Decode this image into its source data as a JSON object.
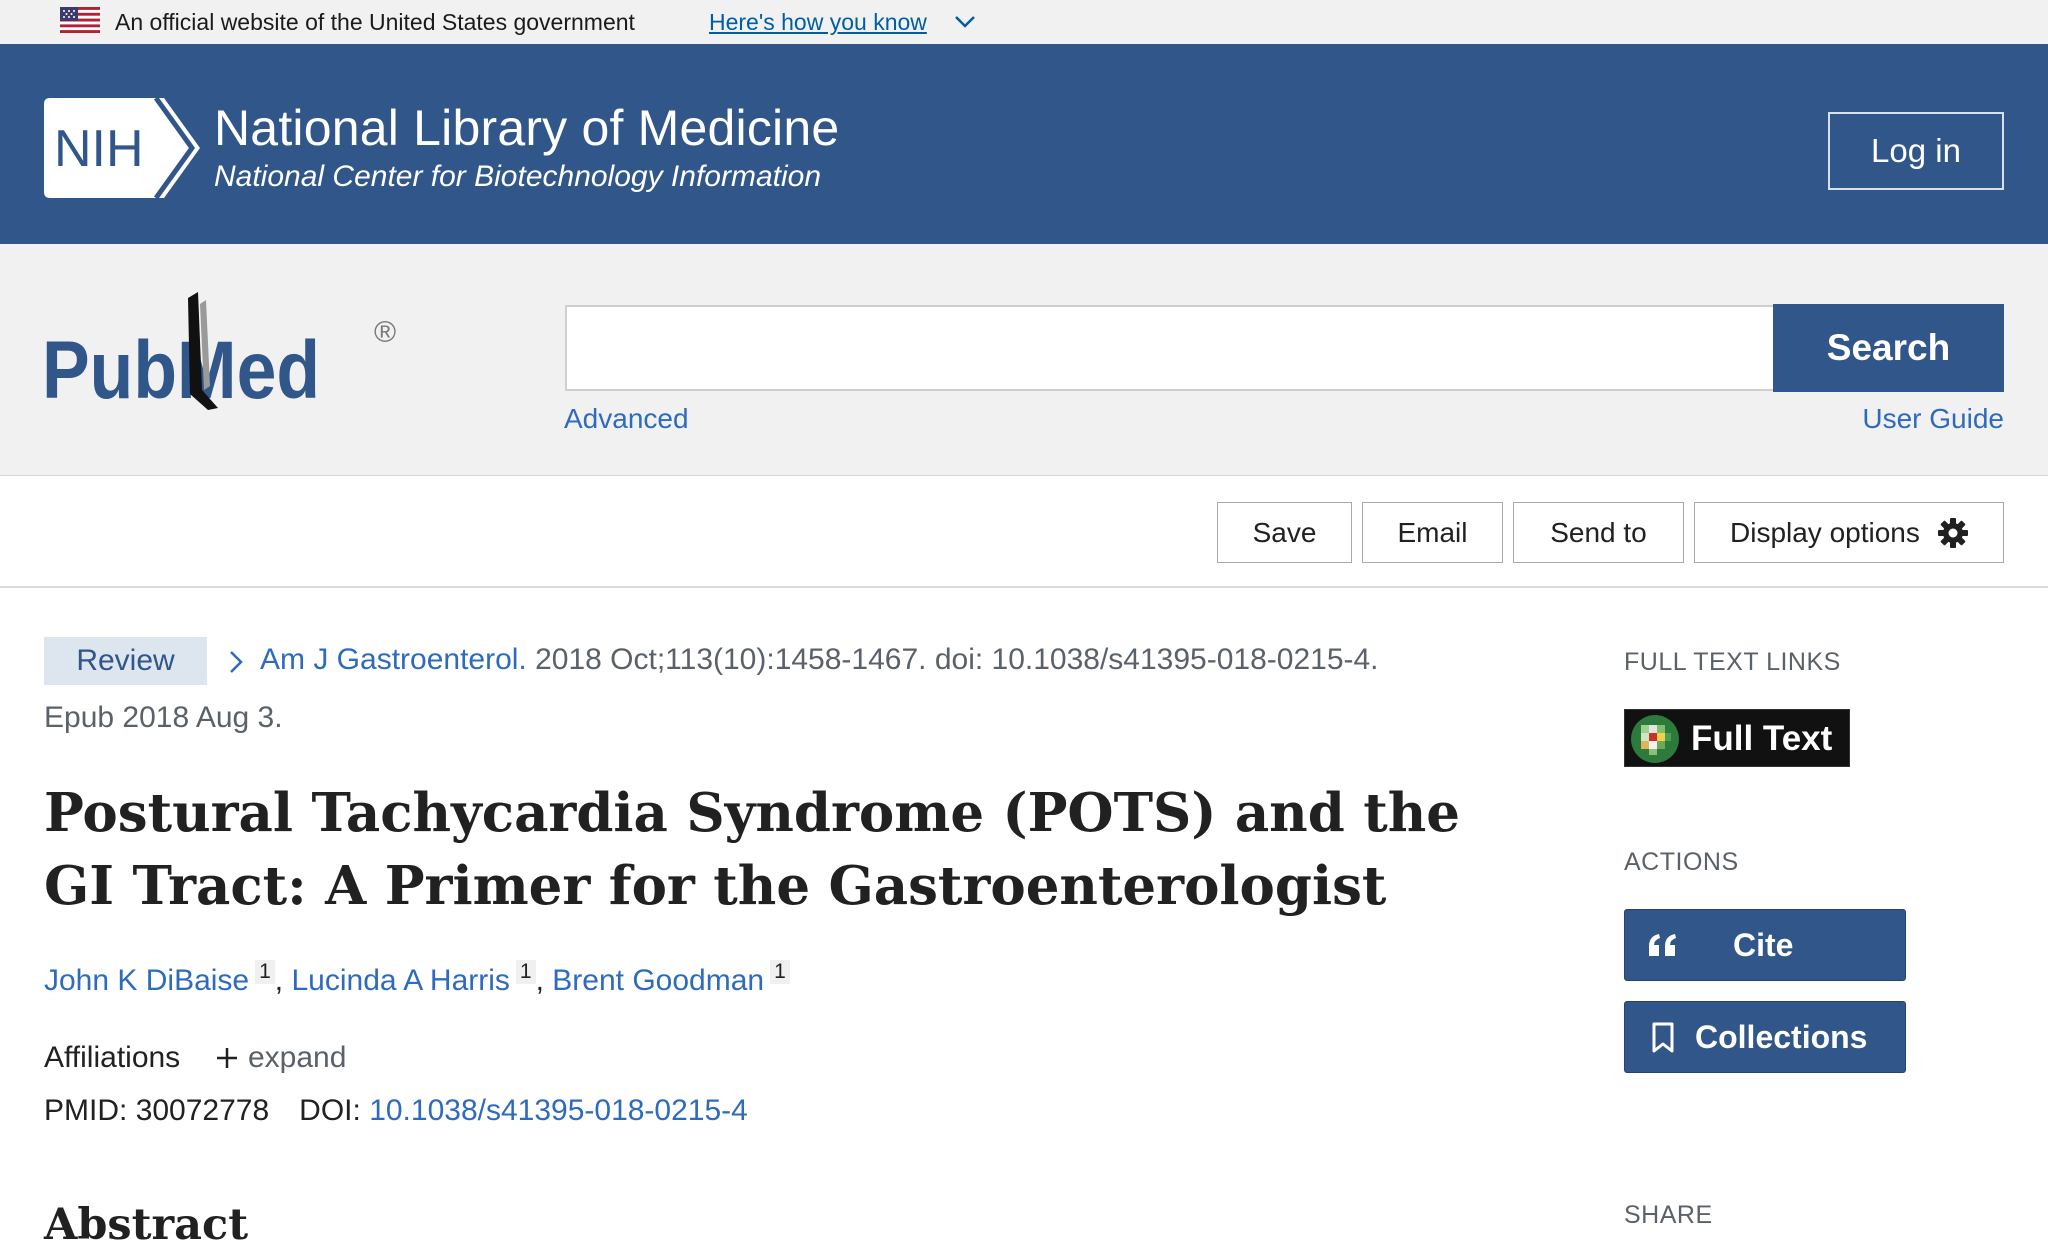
{
  "gov_banner": {
    "text": "An official website of the United States government",
    "link": "Here's how you know"
  },
  "header": {
    "logo_text": "NIH",
    "title": "National Library of Medicine",
    "subtitle": "National Center for Biotechnology Information",
    "login": "Log in"
  },
  "search": {
    "logo_text": "PubMed",
    "logo_mark": "®",
    "value": "",
    "button": "Search",
    "advanced": "Advanced",
    "user_guide": "User Guide"
  },
  "toolbar": {
    "save": "Save",
    "email": "Email",
    "send_to": "Send to",
    "display_options": "Display options"
  },
  "article": {
    "type": "Review",
    "journal": "Am J Gastroenterol.",
    "citation": " 2018 Oct;113(10):1458-1467. doi: 10.1038/s41395-018-0215-4.",
    "epub": "Epub 2018 Aug 3.",
    "title": "Postural Tachycardia Syndrome (POTS) and the GI Tract: A Primer for the Gastroenterologist",
    "authors": [
      {
        "name": "John K DiBaise",
        "aff": "1"
      },
      {
        "name": "Lucinda A Harris",
        "aff": "1"
      },
      {
        "name": "Brent Goodman",
        "aff": "1"
      }
    ],
    "affiliations_label": "Affiliations",
    "expand": "expand",
    "pmid_label": "PMID:",
    "pmid": "30072778",
    "doi_label": "DOI:",
    "doi": "10.1038/s41395-018-0215-4",
    "abstract_heading": "Abstract"
  },
  "sidebar": {
    "full_text_links_heading": "FULL TEXT LINKS",
    "full_text_button": "Full Text",
    "actions_heading": "ACTIONS",
    "cite": "Cite",
    "collections": "Collections",
    "share_heading": "SHARE"
  },
  "colors": {
    "nih_blue": "#30568a",
    "link_blue": "#2e6bbd",
    "banner_gray": "#f1f1f1"
  },
  "icons": [
    "us-flag-icon",
    "chevron-down-icon",
    "nih-logo-icon",
    "pubmed-logo",
    "gear-icon",
    "chevron-right-icon",
    "plus-icon",
    "full-text-logo-icon",
    "quote-icon",
    "bookmark-icon"
  ]
}
